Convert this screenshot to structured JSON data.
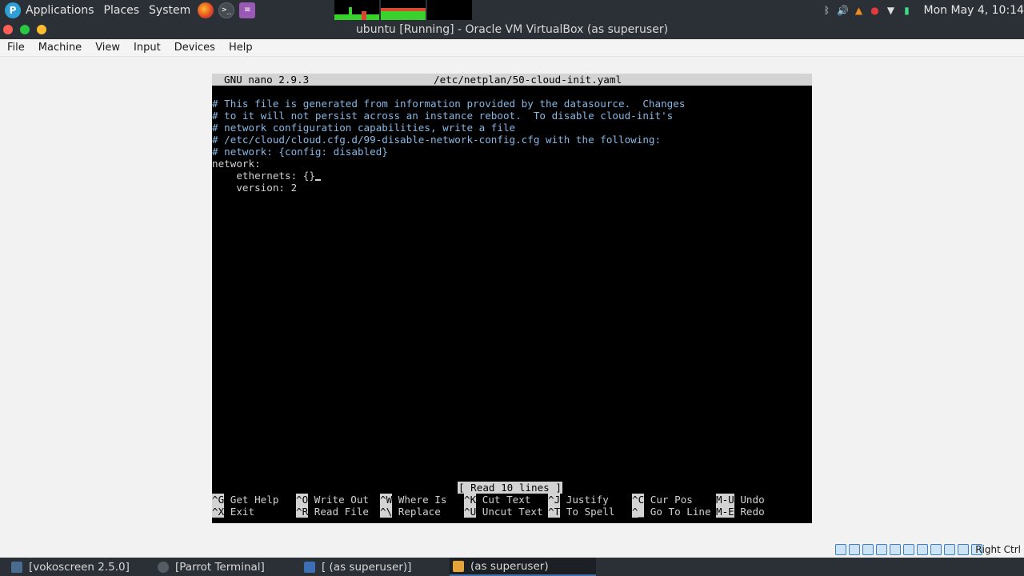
{
  "top_panel": {
    "menus": [
      "Applications",
      "Places",
      "System"
    ],
    "clock": "Mon May 4, 10:14"
  },
  "window": {
    "title": "ubuntu [Running] - Oracle VM VirtualBox (as superuser)",
    "menu": [
      "File",
      "Machine",
      "View",
      "Input",
      "Devices",
      "Help"
    ],
    "host_key": "Right Ctrl"
  },
  "nano": {
    "version": "GNU nano 2.9.3",
    "filename": "/etc/netplan/50-cloud-init.yaml",
    "lines": [
      "# This file is generated from information provided by the datasource.  Changes",
      "# to it will not persist across an instance reboot.  To disable cloud-init's",
      "# network configuration capabilities, write a file",
      "# /etc/cloud/cloud.cfg.d/99-disable-network-config.cfg with the following:",
      "# network: {config: disabled}",
      "network:",
      "    ethernets: {}",
      "    version: 2"
    ],
    "status": "[ Read 10 lines ]",
    "shortcuts_row1": [
      {
        "key": "^G",
        "label": "Get Help"
      },
      {
        "key": "^O",
        "label": "Write Out"
      },
      {
        "key": "^W",
        "label": "Where Is"
      },
      {
        "key": "^K",
        "label": "Cut Text"
      },
      {
        "key": "^J",
        "label": "Justify"
      },
      {
        "key": "^C",
        "label": "Cur Pos"
      },
      {
        "key": "M-U",
        "label": "Undo"
      }
    ],
    "shortcuts_row2": [
      {
        "key": "^X",
        "label": "Exit"
      },
      {
        "key": "^R",
        "label": "Read File"
      },
      {
        "key": "^\\",
        "label": "Replace"
      },
      {
        "key": "^U",
        "label": "Uncut Text"
      },
      {
        "key": "^T",
        "label": "To Spell"
      },
      {
        "key": "^_",
        "label": "Go To Line"
      },
      {
        "key": "M-E",
        "label": "Redo"
      }
    ]
  },
  "taskbar": {
    "items": [
      "[vokoscreen 2.5.0]",
      "[Parrot Terminal]",
      "[ (as superuser)]",
      "(as superuser)"
    ]
  },
  "colors": {
    "panel_bg": "#2b3036",
    "comment_text": "#87b7e3",
    "nano_bar": "#d3d3d3",
    "close": "#ff5f57",
    "minimize": "#28c840",
    "maximize": "#febc2e"
  }
}
